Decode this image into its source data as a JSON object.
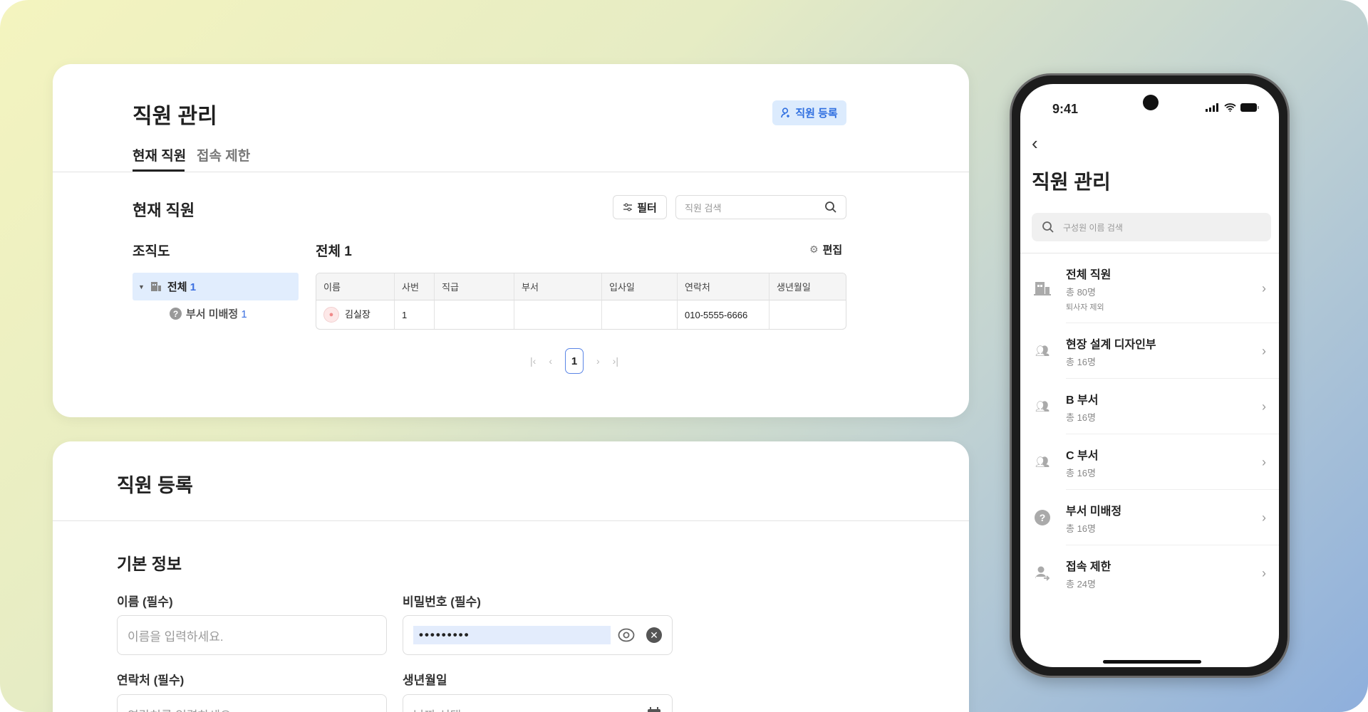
{
  "desktop": {
    "title": "직원 관리",
    "register_button": "직원 등록",
    "tabs": [
      {
        "label": "현재 직원",
        "active": true
      },
      {
        "label": "접속 제한",
        "active": false
      }
    ],
    "section_title": "현재 직원",
    "filter_button": "필터",
    "search_placeholder": "직원 검색",
    "org_title": "조직도",
    "org_tree": [
      {
        "label": "전체",
        "count": "1"
      },
      {
        "label": "부서 미배정",
        "count": "1"
      }
    ],
    "list_title": "전체 1",
    "edit_button": "편집",
    "columns": [
      "이름",
      "사번",
      "직급",
      "부서",
      "입사일",
      "연락처",
      "생년월일"
    ],
    "rows": [
      [
        "김실장",
        "1",
        "",
        "",
        "",
        "010-5555-6666",
        ""
      ]
    ],
    "pagination": {
      "current": "1"
    }
  },
  "register": {
    "title": "직원 등록",
    "section": "기본 정보",
    "fields": [
      {
        "label": "이름 (필수)",
        "placeholder": "이름을 입력하세요."
      },
      {
        "label": "비밀번호 (필수)",
        "value": "•••••••••"
      },
      {
        "label": "연락처 (필수)",
        "placeholder": "연락처를 입력하세요."
      },
      {
        "label": "생년월일",
        "placeholder": "날짜 선택"
      }
    ]
  },
  "mobile": {
    "time": "9:41",
    "title": "직원 관리",
    "search_placeholder": "구성원 이름 검색",
    "items": [
      {
        "title": "전체 직원",
        "sub": "총 80명",
        "note": "퇴사자 제외",
        "icon": "building-icon"
      },
      {
        "title": "현장 설계 디자인부",
        "sub": "총 16명",
        "icon": "group-icon"
      },
      {
        "title": "B 부서",
        "sub": "총 16명",
        "icon": "group-icon"
      },
      {
        "title": "C 부서",
        "sub": "총 16명",
        "icon": "group-icon"
      },
      {
        "title": "부서 미배정",
        "sub": "총 16명",
        "icon": "question-icon"
      },
      {
        "title": "접속 제한",
        "sub": "총 24명",
        "icon": "user-blocked-icon"
      }
    ]
  },
  "colors": {
    "accent": "#3b6fe0",
    "accent_bg": "#dcebfd"
  }
}
